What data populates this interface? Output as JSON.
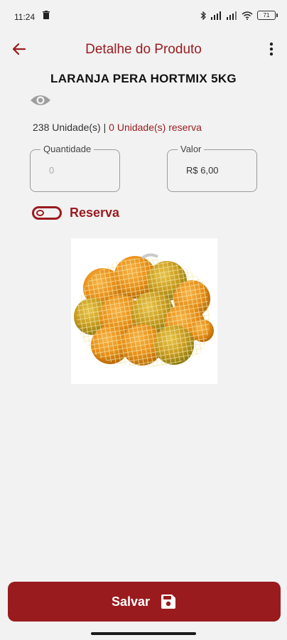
{
  "status_bar": {
    "time": "11:24",
    "battery": "71"
  },
  "app_bar": {
    "title": "Detalhe do Produto",
    "back_icon": "arrow-left-icon",
    "more_icon": "more-vertical-icon"
  },
  "product": {
    "name": "LARANJA PERA HORTMIX 5KG",
    "stock_units": "238 Unidade(s)",
    "separator": " | ",
    "reserved_units": "0 Unidade(s) reserva",
    "image_icon": "orange-bag-image"
  },
  "fields": {
    "quantity_label": "Quantidade",
    "quantity_placeholder": "0",
    "value_label": "Valor",
    "value": "R$ 6,00"
  },
  "reserve_toggle": {
    "label": "Reserva",
    "on": false
  },
  "footer": {
    "save_label": "Salvar",
    "save_icon": "floppy-disk-icon"
  },
  "colors": {
    "accent": "#9a1b1f",
    "button": "#991b1e",
    "background": "#f2f2f2"
  }
}
